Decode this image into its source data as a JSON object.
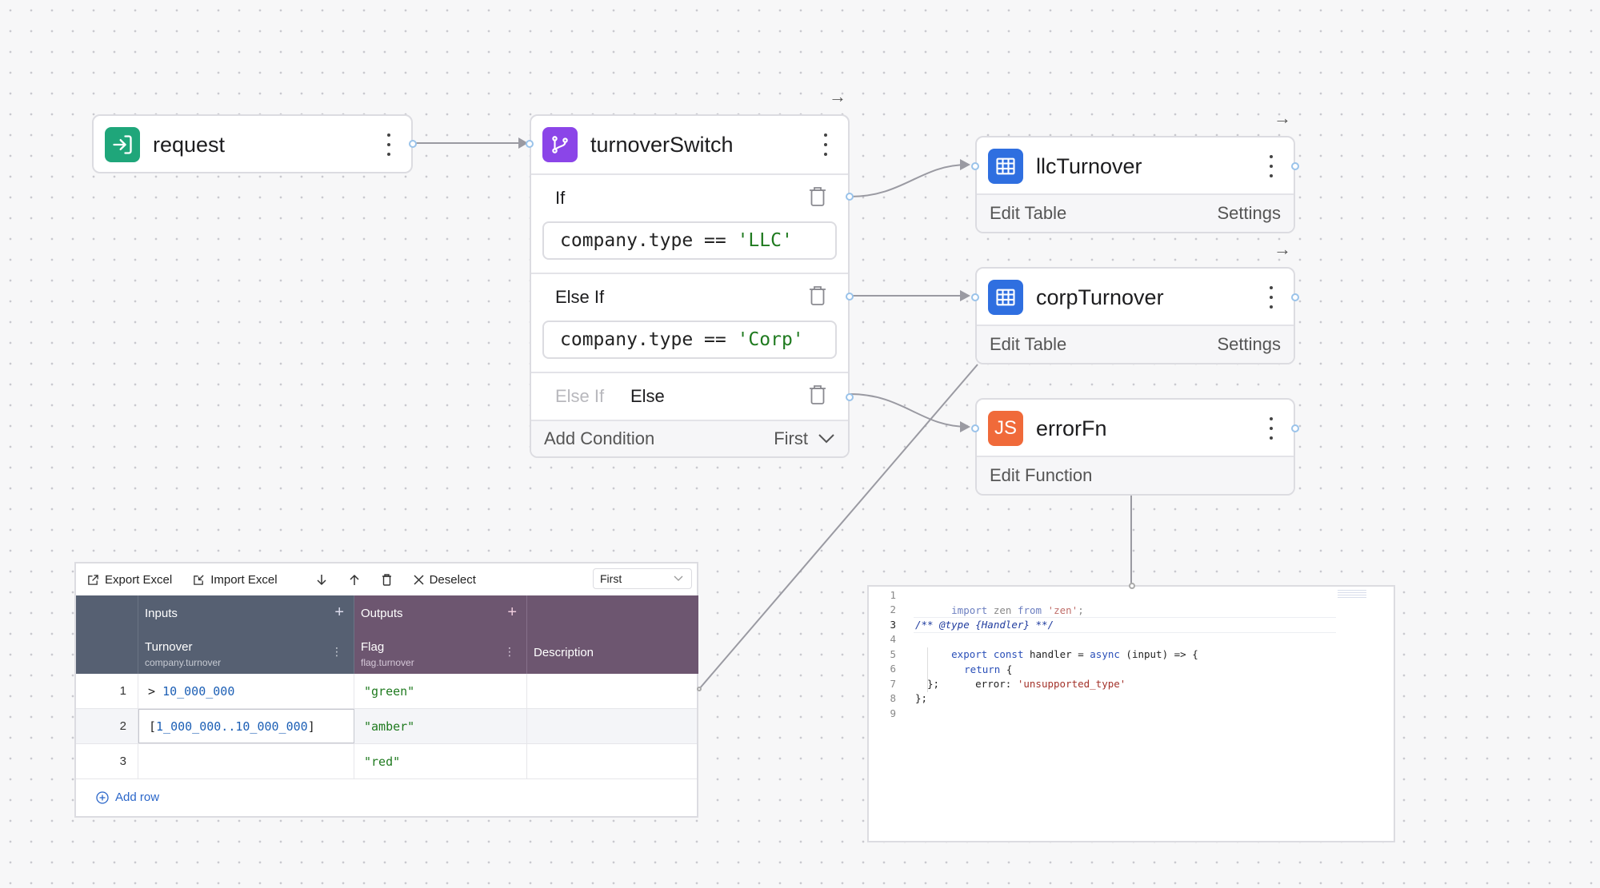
{
  "nodes": {
    "request": {
      "title": "request"
    },
    "switch": {
      "title": "turnoverSwitch",
      "conditions": [
        {
          "label": "If",
          "expr_prefix": "company.type == ",
          "expr_string": "'LLC'"
        },
        {
          "label": "Else If",
          "expr_prefix": "company.type == ",
          "expr_string": "'Corp'"
        }
      ],
      "else_placeholder": "Else If",
      "else_label": "Else",
      "add_condition": "Add Condition",
      "mode": "First"
    },
    "llc": {
      "title": "llcTurnover",
      "left_action": "Edit Table",
      "right_action": "Settings"
    },
    "corp": {
      "title": "corpTurnover",
      "left_action": "Edit Table",
      "right_action": "Settings"
    },
    "error": {
      "title": "errorFn",
      "icon_text": "JS",
      "action": "Edit Function"
    }
  },
  "table": {
    "toolbar": {
      "export": "Export Excel",
      "import": "Import Excel",
      "deselect": "Deselect",
      "hit_policy": "First"
    },
    "groups": {
      "inputs": "Inputs",
      "outputs": "Outputs"
    },
    "columns": [
      {
        "name": "Turnover",
        "field": "company.turnover"
      },
      {
        "name": "Flag",
        "field": "flag.turnover"
      },
      {
        "name": "Description"
      }
    ],
    "rows": [
      {
        "n": "1",
        "turnover_op": "> ",
        "turnover_val": "10_000_000",
        "flag": "\"green\""
      },
      {
        "n": "2",
        "turnover_op": "[",
        "turnover_val": "1_000_000..10_000_000",
        "turnover_close": "]",
        "flag": "\"amber\""
      },
      {
        "n": "3",
        "turnover_op": "",
        "turnover_val": "",
        "flag": "\"red\""
      }
    ],
    "add_row": "Add row"
  },
  "code": {
    "line_numbers": [
      "1",
      "2",
      "3",
      "4",
      "5",
      "6",
      "7",
      "8",
      "9"
    ],
    "l1": {
      "kw1": "import",
      "id": " zen ",
      "kw2": "from",
      "sp": " ",
      "str": "'zen'",
      "end": ";"
    },
    "l3": "/** @type {Handler} **/",
    "l4": {
      "kw1": "export const",
      "id": " handler = ",
      "kw2": "async",
      "rest": " (input) => {"
    },
    "l5": {
      "kw": "return",
      "rest": " {"
    },
    "l6": {
      "key": "error: ",
      "str": "'unsupported_type'"
    },
    "l7": "};",
    "l8": "};"
  },
  "colors": {
    "request_icon": "#1fa67a",
    "switch_icon": "#8b45e8",
    "table_icon": "#2f6fe0",
    "js_icon": "#f06a3a"
  }
}
